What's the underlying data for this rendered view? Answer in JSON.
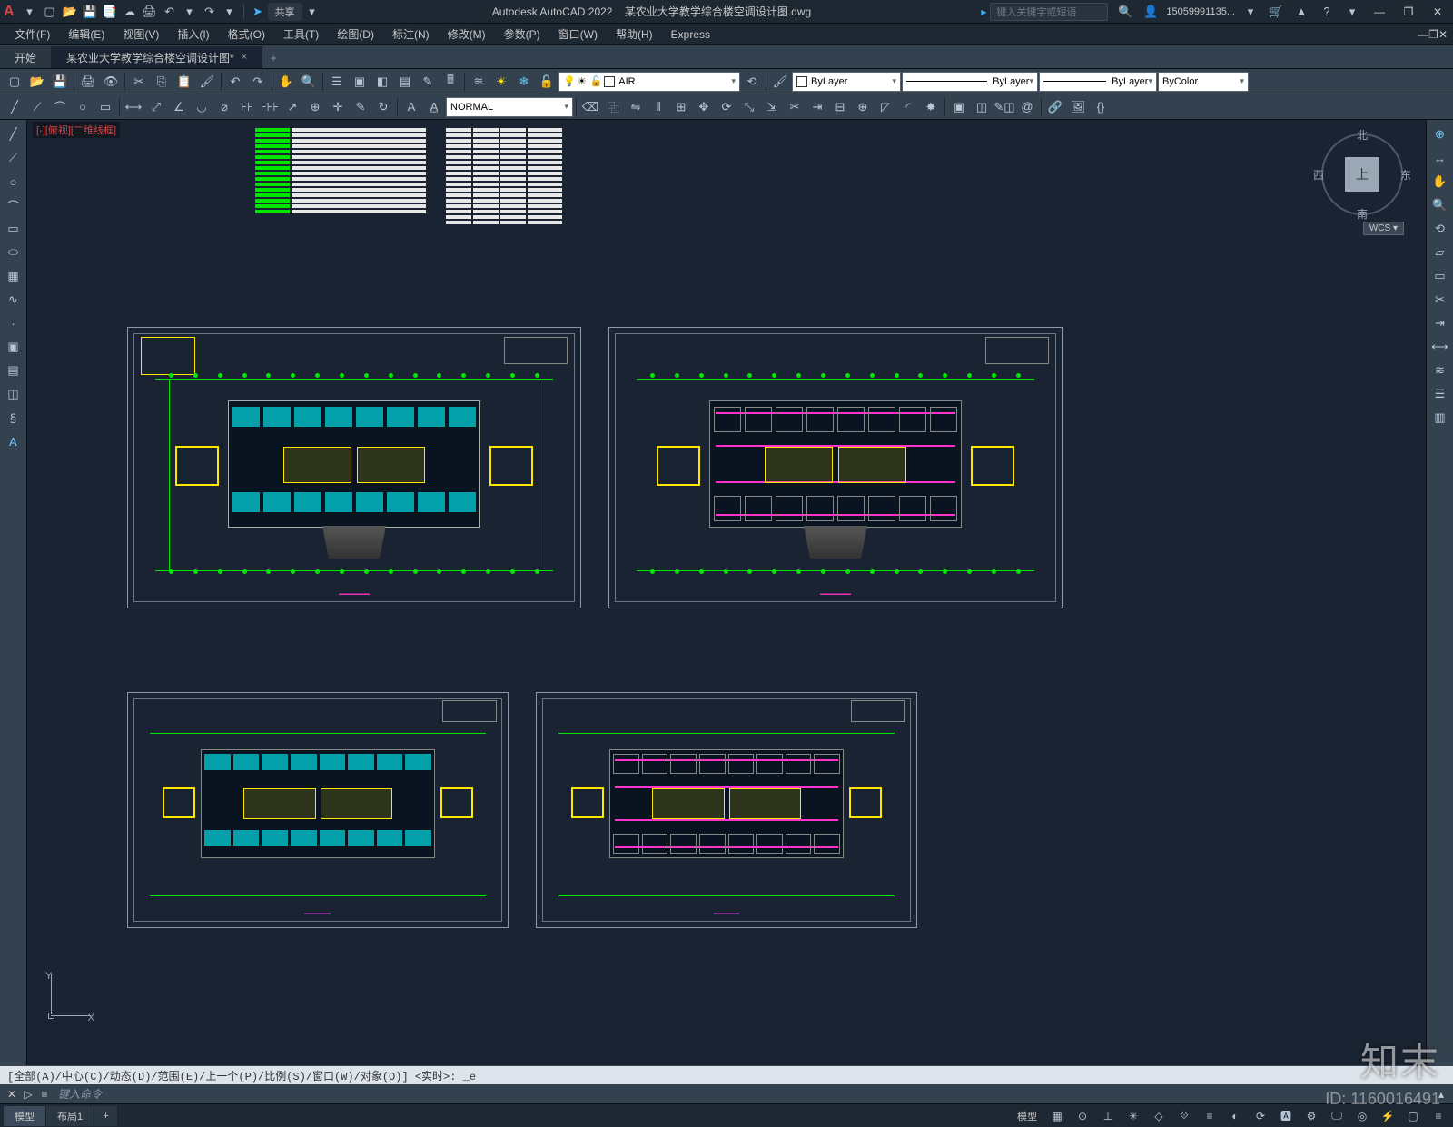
{
  "app": {
    "logo_letter": "A",
    "title_app": "Autodesk AutoCAD 2022",
    "title_file": "某农业大学教学综合楼空调设计图.dwg",
    "share_label": "共享",
    "search_placeholder": "键入关键字或短语",
    "user_name": "15059991135...",
    "dropdown_glyph": "▾"
  },
  "qat_icons": [
    "new",
    "open",
    "save",
    "saveas",
    "print",
    "undo",
    "redo"
  ],
  "window_controls": {
    "min": "—",
    "restore": "❐",
    "close": "✕"
  },
  "menubar": [
    "文件(F)",
    "编辑(E)",
    "视图(V)",
    "插入(I)",
    "格式(O)",
    "工具(T)",
    "绘图(D)",
    "标注(N)",
    "修改(M)",
    "参数(P)",
    "窗口(W)",
    "帮助(H)",
    "Express"
  ],
  "tabs": {
    "start_tab": "开始",
    "file_tab": "某农业大学教学综合楼空调设计图*",
    "close_glyph": "×",
    "plus_glyph": "+"
  },
  "toolbar1": {
    "layer_dropdown": {
      "swatch_color": "#ff33cc",
      "name": "AIR",
      "sun_glyph": "☀",
      "freeze_glyph": "❄",
      "lock_glyph": "🔓",
      "bulb_glyph": "💡"
    },
    "prop_layer": "ByLayer",
    "prop_ltype": "ByLayer",
    "prop_lweight": "ByLayer",
    "prop_color": "ByColor"
  },
  "toolbar2": {
    "textstyle_dropdown": "NORMAL"
  },
  "left_tools": [
    "line",
    "polyline",
    "circle",
    "arc",
    "rectangle",
    "ellipse",
    "hatch",
    "spline",
    "point",
    "block",
    "table",
    "mtext",
    "region",
    "helix"
  ],
  "right_tools": [
    "distance",
    "area",
    "angle",
    "measure",
    "id",
    "list",
    "extend",
    "trim",
    "dim",
    "layer",
    "props",
    "palette"
  ],
  "viewport": {
    "label": "[-][俯视][二维线框]",
    "ucs": {
      "x": "X",
      "y": "Y"
    },
    "viewcube": {
      "face": "上",
      "n": "北",
      "s": "南",
      "e": "东",
      "w": "西"
    },
    "wcs_badge": "WCS ▾"
  },
  "cmdline": {
    "history": "[全部(A)/中心(C)/动态(D)/范围(E)/上一个(P)/比例(S)/窗口(W)/对象(O)] <实时>: _e",
    "prompt_glyph": "▷",
    "hamburger_glyph": "≡",
    "input_placeholder": "键入命令"
  },
  "statusbar": {
    "tabs": [
      "模型",
      "布局1"
    ],
    "plus_glyph": "+",
    "right_label": "模型"
  },
  "watermark": {
    "brand": "知末",
    "id": "ID: 1160016491"
  },
  "icons": {
    "new": "▢",
    "open": "📂",
    "save": "💾",
    "saveas": "📑",
    "print": "🖨",
    "undo": "↶",
    "redo": "↷",
    "search": "🔍",
    "cart": "🛒",
    "user": "👤",
    "help": "?",
    "cloud": "☁",
    "autodesk": "▲",
    "line": "╱",
    "polyline": "⟋",
    "circle": "○",
    "arc": "⌒",
    "rectangle": "▭",
    "ellipse": "⬭",
    "hatch": "▦",
    "spline": "∿",
    "point": "·",
    "block": "▣",
    "table": "▤",
    "mtext": "A",
    "region": "◫",
    "helix": "§",
    "distance": "↔",
    "area": "▱",
    "angle": "∠",
    "measure": "📏",
    "id": "ⓘ",
    "list": "≡",
    "extend": "⇥",
    "trim": "✂",
    "dim": "⟷",
    "layer": "≋",
    "props": "☰",
    "palette": "▥",
    "pan": "✋",
    "zoom": "🔍",
    "orbit": "⟲",
    "grid": "▦",
    "snap": "⊙",
    "ortho": "⊥",
    "polar": "✳",
    "osnap": "◇",
    "lwt": "≡",
    "gear": "⚙"
  }
}
